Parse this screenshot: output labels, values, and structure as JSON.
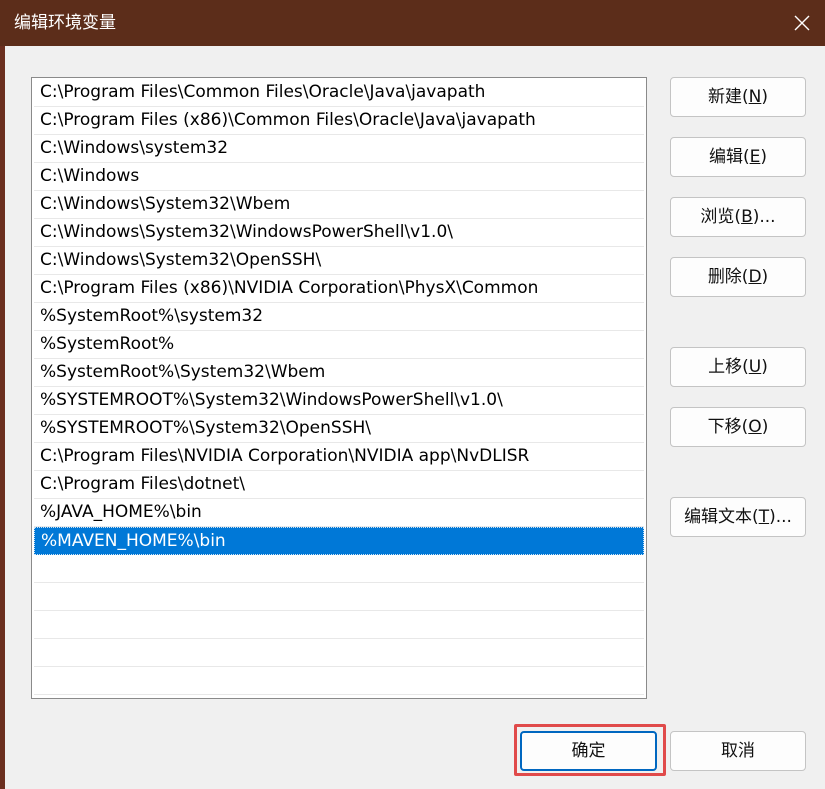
{
  "window": {
    "title": "编辑环境变量",
    "close_icon": "close-icon"
  },
  "list": {
    "items": [
      "C:\\Program Files\\Common Files\\Oracle\\Java\\javapath",
      "C:\\Program Files (x86)\\Common Files\\Oracle\\Java\\javapath",
      "C:\\Windows\\system32",
      "C:\\Windows",
      "C:\\Windows\\System32\\Wbem",
      "C:\\Windows\\System32\\WindowsPowerShell\\v1.0\\",
      "C:\\Windows\\System32\\OpenSSH\\",
      "C:\\Program Files (x86)\\NVIDIA Corporation\\PhysX\\Common",
      "%SystemRoot%\\system32",
      "%SystemRoot%",
      "%SystemRoot%\\System32\\Wbem",
      "%SYSTEMROOT%\\System32\\WindowsPowerShell\\v1.0\\",
      "%SYSTEMROOT%\\System32\\OpenSSH\\",
      "C:\\Program Files\\NVIDIA Corporation\\NVIDIA app\\NvDLISR",
      "C:\\Program Files\\dotnet\\",
      "%JAVA_HOME%\\bin",
      "%MAVEN_HOME%\\bin"
    ],
    "selected_index": 16
  },
  "buttons": {
    "new": {
      "label": "新建(",
      "key": "N",
      "suffix": ")"
    },
    "edit": {
      "label": "编辑(",
      "key": "E",
      "suffix": ")"
    },
    "browse": {
      "label": "浏览(",
      "key": "B",
      "suffix": ")..."
    },
    "delete": {
      "label": "删除(",
      "key": "D",
      "suffix": ")"
    },
    "move_up": {
      "label": "上移(",
      "key": "U",
      "suffix": ")"
    },
    "move_down": {
      "label": "下移(",
      "key": "O",
      "suffix": ")"
    },
    "edit_text": {
      "label": "编辑文本(",
      "key": "T",
      "suffix": ")..."
    },
    "ok": "确定",
    "cancel": "取消"
  },
  "colors": {
    "titlebar": "#5c2d1a",
    "selection": "#0078d7",
    "highlight": "#e04a4a"
  }
}
